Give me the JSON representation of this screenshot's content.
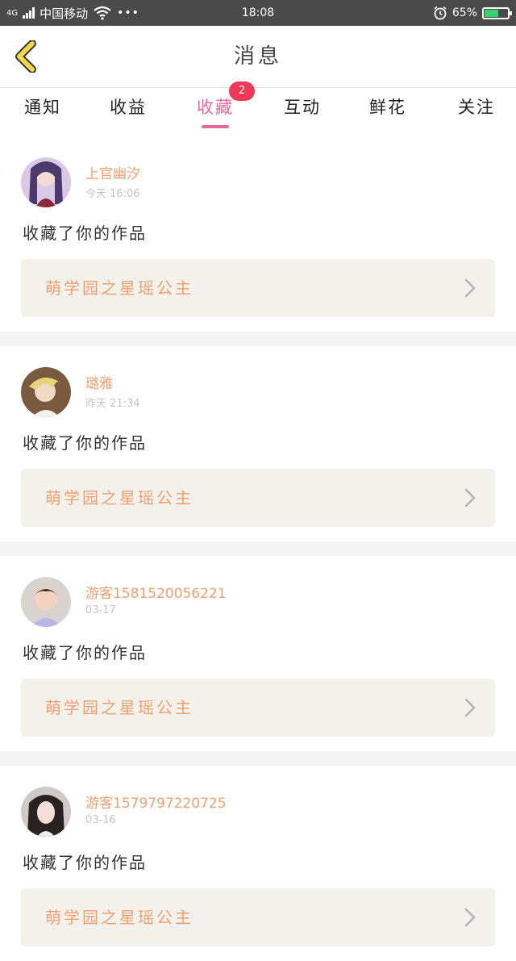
{
  "statusbar": {
    "network": "4G",
    "carrier": "中国移动",
    "dots": "•••",
    "time": "18:08",
    "battery": "65%",
    "battery_level": 0.65,
    "icons": [
      "signal-icon",
      "wifi-icon",
      "alarm-icon",
      "battery-icon"
    ]
  },
  "header": {
    "title": "消息",
    "back_icon": "chevron-left-icon",
    "accent": "#f5d84a"
  },
  "tabs": [
    {
      "label": "通知"
    },
    {
      "label": "收益"
    },
    {
      "label": "收藏",
      "active": true,
      "badge": "2"
    },
    {
      "label": "互动"
    },
    {
      "label": "鲜花"
    },
    {
      "label": "关注"
    }
  ],
  "colors": {
    "tab_active": "#e8699b",
    "badge": "#f03a55",
    "name": "#f0a070",
    "work_bg": "#f2f1ec"
  },
  "items": [
    {
      "name": "上官幽汐",
      "time": "今天 16:06",
      "action": "收藏了你的作品",
      "work": "萌学园之星瑶公主",
      "avatar": "avatar"
    },
    {
      "name": "璐雅",
      "time": "昨天 21:34",
      "action": "收藏了你的作品",
      "work": "萌学园之星瑶公主",
      "avatar": "avatar"
    },
    {
      "name": "游客1581520056221",
      "time": "03-17",
      "action": "收藏了你的作品",
      "work": "萌学园之星瑶公主",
      "avatar": "avatar"
    },
    {
      "name": "游客1579797220725",
      "time": "03-16",
      "action": "收藏了你的作品",
      "work": "萌学园之星瑶公主",
      "avatar": "avatar"
    }
  ]
}
